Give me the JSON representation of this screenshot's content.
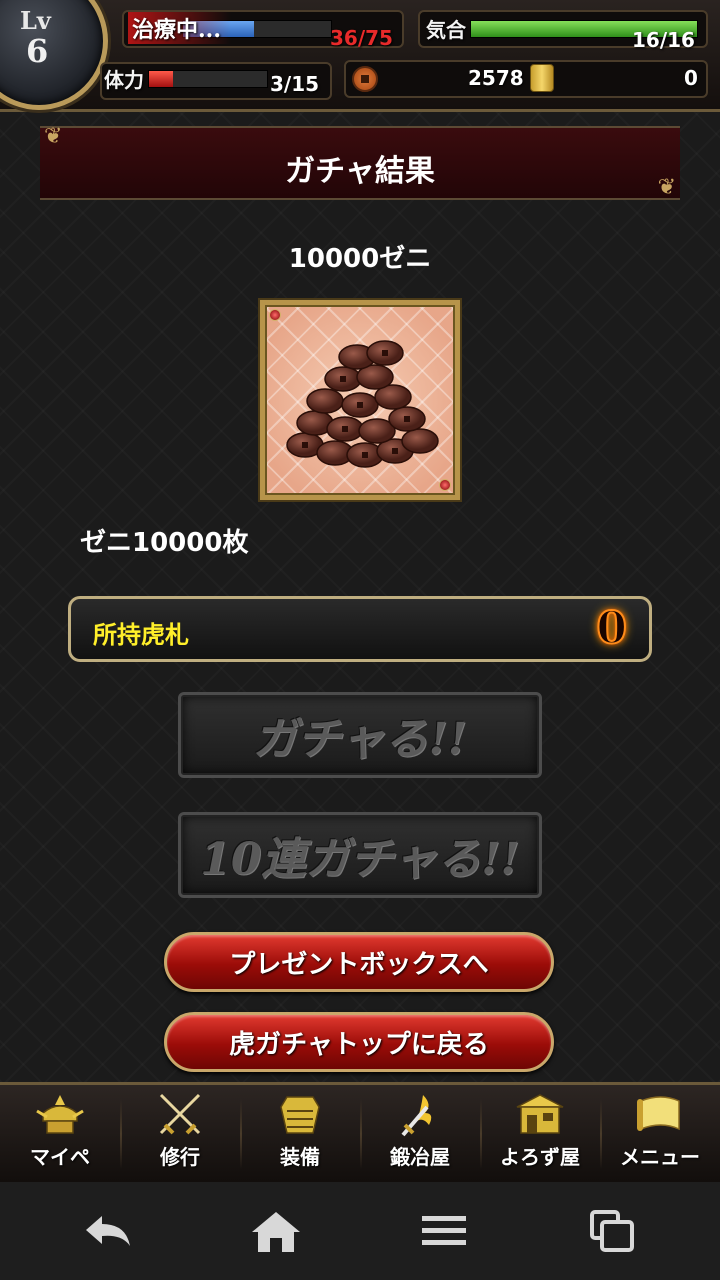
{
  "status": {
    "level_label": "Lv",
    "level": "6",
    "hp_status": "治療中...",
    "hp_value": "36/75",
    "hp_fill": 0.48,
    "spirit_label": "気合",
    "spirit_value": "16/16",
    "spirit_fill": 1.0,
    "stamina_label": "体力",
    "stamina_value": "3/15",
    "stamina_fill": 0.2,
    "coins": "2578",
    "gold": "0"
  },
  "page": {
    "title": "ガチャ結果",
    "result_heading": "10000ゼニ",
    "item_description": "ゼニ10000枚",
    "owned_label": "所持虎札",
    "owned_value": "0"
  },
  "buttons": {
    "gacha": "ガチャる!!",
    "gacha10": "10連ガチャる!!",
    "present_box": "プレゼントボックスへ",
    "back_to_top": "虎ガチャトップに戻る"
  },
  "game_nav": [
    {
      "label": "マイペ",
      "icon": "samurai-helmet-icon"
    },
    {
      "label": "修行",
      "icon": "crossed-swords-icon"
    },
    {
      "label": "装備",
      "icon": "armor-icon"
    },
    {
      "label": "鍛冶屋",
      "icon": "flaming-sword-icon"
    },
    {
      "label": "よろず屋",
      "icon": "shop-icon"
    },
    {
      "label": "メニュー",
      "icon": "scroll-icon"
    }
  ],
  "colors": {
    "hp_bar": "#3a7bd5",
    "spirit_bar": "#4caf2a",
    "stamina_bar": "#d42020",
    "accent_gold": "#c9a562",
    "owned_label": "#ffef2a"
  }
}
